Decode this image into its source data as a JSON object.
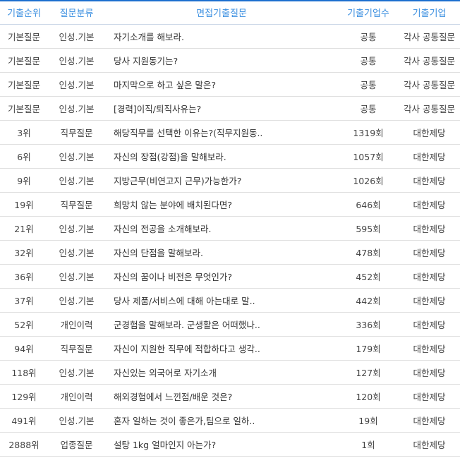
{
  "table": {
    "headers": [
      "기출순위",
      "질문분류",
      "면접기출질문",
      "기출기업수",
      "기출기업"
    ],
    "rows": [
      {
        "rank": "기본질문",
        "category": "인성.기본",
        "question": "자기소개를 해보라.",
        "count": "공통",
        "company": "각사 공통질문"
      },
      {
        "rank": "기본질문",
        "category": "인성.기본",
        "question": "당사 지원동기는?",
        "count": "공통",
        "company": "각사 공통질문"
      },
      {
        "rank": "기본질문",
        "category": "인성.기본",
        "question": "마지막으로 하고 싶은 말은?",
        "count": "공통",
        "company": "각사 공통질문"
      },
      {
        "rank": "기본질문",
        "category": "인성.기본",
        "question": "[경력]이직/퇴직사유는?",
        "count": "공통",
        "company": "각사 공통질문"
      },
      {
        "rank": "3위",
        "category": "직무질문",
        "question": "해당직무를 선택한 이유는?(직무지원동..",
        "count": "1319회",
        "company": "대한제당"
      },
      {
        "rank": "6위",
        "category": "인성.기본",
        "question": "자신의 장점(강점)을 말해보라.",
        "count": "1057회",
        "company": "대한제당"
      },
      {
        "rank": "9위",
        "category": "인성.기본",
        "question": "지방근무(비연고지 근무)가능한가?",
        "count": "1026회",
        "company": "대한제당"
      },
      {
        "rank": "19위",
        "category": "직무질문",
        "question": "희망치 않는 분야에 배치된다면?",
        "count": "646회",
        "company": "대한제당"
      },
      {
        "rank": "21위",
        "category": "인성.기본",
        "question": "자신의 전공을 소개해보라.",
        "count": "595회",
        "company": "대한제당"
      },
      {
        "rank": "32위",
        "category": "인성.기본",
        "question": "자신의 단점을 말해보라.",
        "count": "478회",
        "company": "대한제당"
      },
      {
        "rank": "36위",
        "category": "인성.기본",
        "question": "자신의 꿈이나 비전은 무엇인가?",
        "count": "452회",
        "company": "대한제당"
      },
      {
        "rank": "37위",
        "category": "인성.기본",
        "question": "당사 제품/서비스에 대해 아는대로 말..",
        "count": "442회",
        "company": "대한제당"
      },
      {
        "rank": "52위",
        "category": "개인이력",
        "question": "군경험을 말해보라. 군생활은 어떠했나..",
        "count": "336회",
        "company": "대한제당"
      },
      {
        "rank": "94위",
        "category": "직무질문",
        "question": "자신이 지원한 직무에 적합하다고 생각..",
        "count": "179회",
        "company": "대한제당"
      },
      {
        "rank": "118위",
        "category": "인성.기본",
        "question": "자신있는 외국어로 자기소개",
        "count": "127회",
        "company": "대한제당"
      },
      {
        "rank": "129위",
        "category": "개인이력",
        "question": "해외경험에서 느낀점/배운 것은?",
        "count": "120회",
        "company": "대한제당"
      },
      {
        "rank": "491위",
        "category": "인성.기본",
        "question": "혼자 일하는 것이 좋은가,팀으로 일하..",
        "count": "19회",
        "company": "대한제당"
      },
      {
        "rank": "2888위",
        "category": "업종질문",
        "question": "설탕 1kg 얼마인지 아는가?",
        "count": "1회",
        "company": "대한제당"
      }
    ]
  }
}
